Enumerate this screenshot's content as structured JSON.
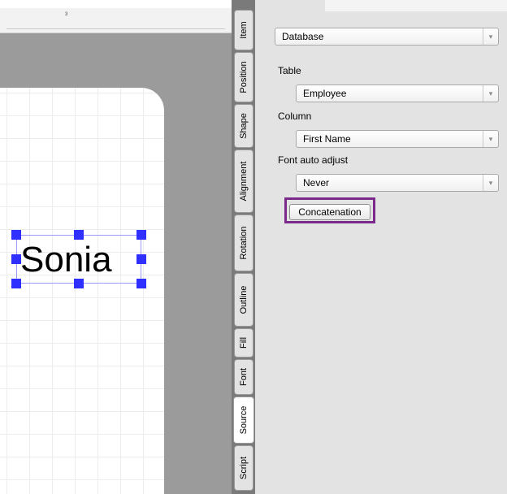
{
  "canvas": {
    "ruler_number": "3",
    "text_object": "Sonia"
  },
  "tabs": [
    {
      "label": "Item",
      "active": false
    },
    {
      "label": "Position",
      "active": false
    },
    {
      "label": "Shape",
      "active": false
    },
    {
      "label": "Alignment",
      "active": false
    },
    {
      "label": "Rotation",
      "active": false
    },
    {
      "label": "Outline",
      "active": false
    },
    {
      "label": "Fill",
      "active": false
    },
    {
      "label": "Font",
      "active": false
    },
    {
      "label": "Source",
      "active": true
    },
    {
      "label": "Script",
      "active": false
    }
  ],
  "panel": {
    "source_type": "Database",
    "table_label": "Table",
    "table_value": "Employee",
    "column_label": "Column",
    "column_value": "First Name",
    "font_auto_adjust_label": "Font auto adjust",
    "font_auto_adjust_value": "Never",
    "concatenation_button": "Concatenation",
    "dropdown_arrow": "▾"
  },
  "colors": {
    "selection_handle": "#2f2fff",
    "highlight_border": "#7b2a8b"
  }
}
